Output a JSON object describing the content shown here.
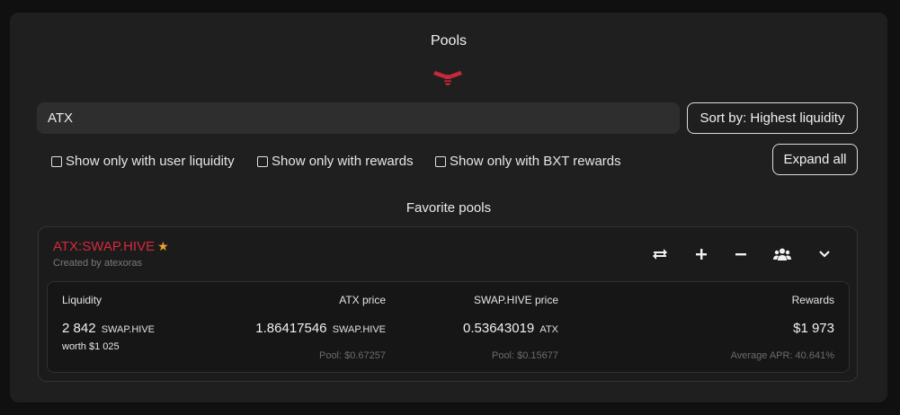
{
  "header": {
    "title": "Pools"
  },
  "search": {
    "value": "ATX",
    "placeholder": ""
  },
  "sort": {
    "label": "Sort by: Highest liquidity"
  },
  "filters": [
    {
      "label": "Show only with user liquidity",
      "checked": false
    },
    {
      "label": "Show only with rewards",
      "checked": false
    },
    {
      "label": "Show only with BXT rewards",
      "checked": false
    }
  ],
  "expand": {
    "label": "Expand all"
  },
  "favorites": {
    "title": "Favorite pools"
  },
  "pool": {
    "name": "ATX:SWAP.HIVE",
    "creator": "Created by atexoras",
    "name_color": "#d6283c",
    "star_color": "#f0a030",
    "icons": [
      "swap-icon",
      "plus-icon",
      "minus-icon",
      "users-icon",
      "chevron-down-icon"
    ],
    "liquidity": {
      "label": "Liquidity",
      "value": "2 842",
      "unit": "SWAP.HIVE",
      "worth": "worth $1 025"
    },
    "base_price": {
      "label": "ATX price",
      "value": "1.86417546",
      "unit": "SWAP.HIVE",
      "pool": "Pool: $0.67257"
    },
    "quote_price": {
      "label": "SWAP.HIVE price",
      "value": "0.53643019",
      "unit": "ATX",
      "pool": "Pool: $0.15677"
    },
    "rewards": {
      "label": "Rewards",
      "value": "$1 973",
      "apr": "Average APR: 40.641%"
    }
  }
}
